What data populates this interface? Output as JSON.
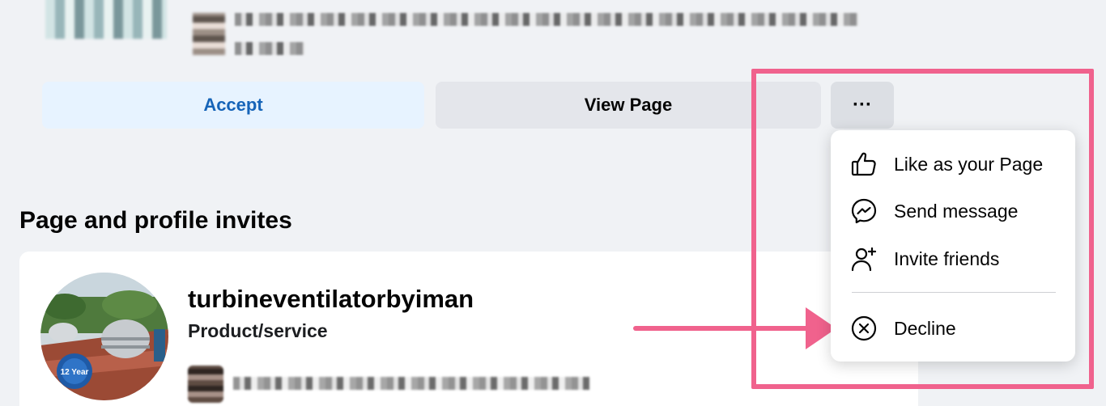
{
  "actions": {
    "accept_label": "Accept",
    "view_page_label": "View Page",
    "more_label": "···"
  },
  "section": {
    "title": "Page and profile invites"
  },
  "invite": {
    "page_name": "turbineventilatorbyiman",
    "category": "Product/service"
  },
  "menu": {
    "items": [
      {
        "label": "Like as your Page",
        "icon": "thumbs-up-icon"
      },
      {
        "label": "Send message",
        "icon": "messenger-icon"
      },
      {
        "label": "Invite friends",
        "icon": "add-person-icon"
      },
      {
        "label": "Decline",
        "icon": "circle-x-icon"
      }
    ]
  },
  "colors": {
    "accept_bg": "#e7f3ff",
    "accept_text": "#1664b8",
    "annotation": "#f0628d",
    "page_bg": "#f0f2f5"
  }
}
